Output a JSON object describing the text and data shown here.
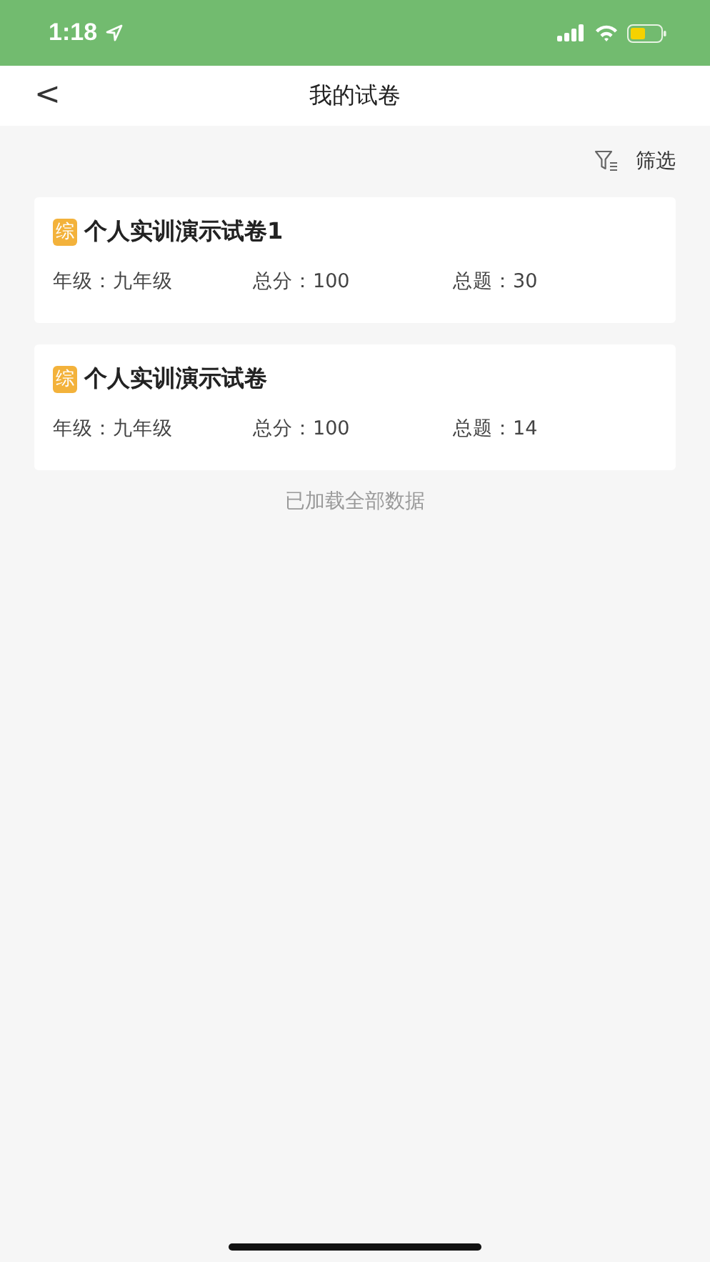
{
  "status_bar": {
    "time": "1:18"
  },
  "nav": {
    "back": "<",
    "title": "我的试卷"
  },
  "filter": {
    "label": "筛选"
  },
  "papers": [
    {
      "tag": "综",
      "title": "个人实训演示试卷1",
      "meta": [
        "年级：九年级",
        "总分：100",
        "总题：30"
      ]
    },
    {
      "tag": "综",
      "title": "个人实训演示试卷",
      "meta": [
        "年级：九年级",
        "总分：100",
        "总题：14"
      ]
    }
  ],
  "footer": "已加载全部数据"
}
